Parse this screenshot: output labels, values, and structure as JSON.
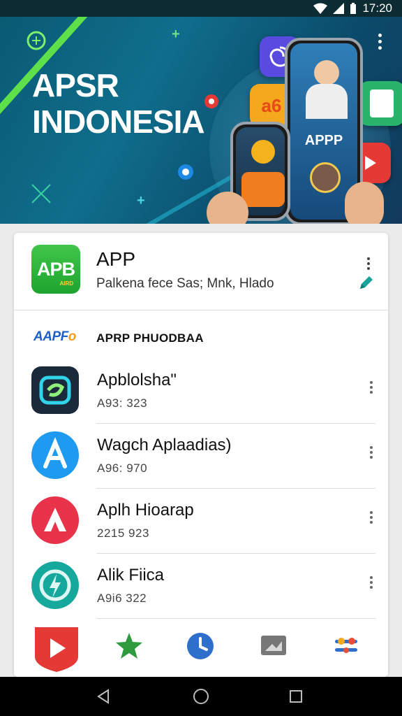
{
  "status_bar": {
    "time": "17:20"
  },
  "hero": {
    "title_line1": "APSR",
    "title_line2": "INDONESIA",
    "phone_label": "APPP",
    "tile_text": "a6"
  },
  "featured": {
    "icon_text": "APB",
    "icon_subtext": "AIRD",
    "title": "APP",
    "subtitle": "Palkena fece Sas; Mnk, Hlado"
  },
  "section": {
    "logo_text": "AAPF",
    "logo_accent": "o",
    "title": "APRP PHUODBAA"
  },
  "apps": [
    {
      "title": "Apblolsha\"",
      "subtitle": "A93: 323",
      "icon": "dark-swirl-icon",
      "color": "#1b2a3a"
    },
    {
      "title": "Wagch Aplaadias)",
      "subtitle": "A96: 970",
      "icon": "app-store-a-icon",
      "color": "#1e88e5"
    },
    {
      "title": "Aplh Hioarap",
      "subtitle": "2215 923",
      "icon": "red-a-icon",
      "color": "#e53935"
    },
    {
      "title": "Alik Fiica",
      "subtitle": "A9i6 322",
      "icon": "teal-bolt-icon",
      "color": "#14a39a"
    }
  ],
  "dock": [
    {
      "name": "play-shield-icon",
      "color": "#e53935"
    },
    {
      "name": "star-icon",
      "color": "#2e9b3e"
    },
    {
      "name": "clock-icon",
      "color": "#2f6fcc"
    },
    {
      "name": "folder-icon",
      "color": "#777777"
    },
    {
      "name": "settings-sliders-icon",
      "color": "#e94e3a"
    }
  ]
}
